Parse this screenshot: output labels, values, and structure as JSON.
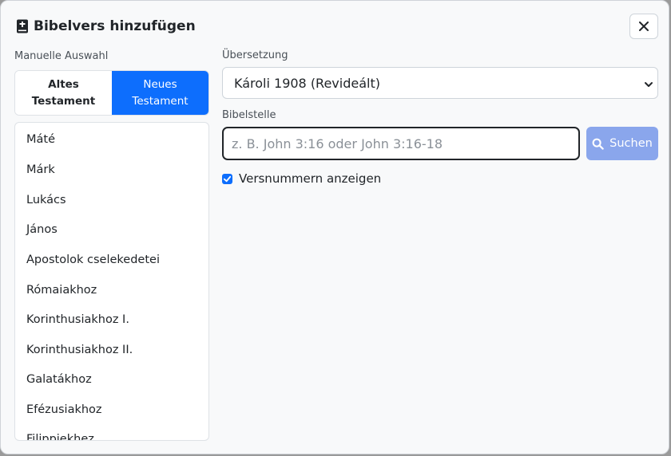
{
  "modal": {
    "title": "Bibelvers hinzufügen",
    "title_icon": "bible-book-icon",
    "close_icon": "close-icon"
  },
  "left": {
    "section_label": "Manuelle Auswahl",
    "tabs": [
      {
        "label": "Altes Testament",
        "active": false
      },
      {
        "label": "Neues Testament",
        "active": true
      }
    ],
    "books": [
      "Máté",
      "Márk",
      "Lukács",
      "János",
      "Apostolok cselekedetei",
      "Rómaiakhoz",
      "Korinthusiakhoz I.",
      "Korinthusiakhoz II.",
      "Galatákhoz",
      "Efézusiakhoz",
      "Filippiekhez"
    ]
  },
  "right": {
    "translation_label": "Übersetzung",
    "translation_value": "Károli 1908 (Revideált)",
    "reference_label": "Bibelstelle",
    "reference_placeholder": "z. B. John 3:16 oder John 3:16-18",
    "search_label": "Suchen",
    "checkbox_label": "Versnummern anzeigen",
    "checkbox_checked": true
  },
  "colors": {
    "accent": "#0d6efd",
    "search_button": "#8aa6ec"
  }
}
